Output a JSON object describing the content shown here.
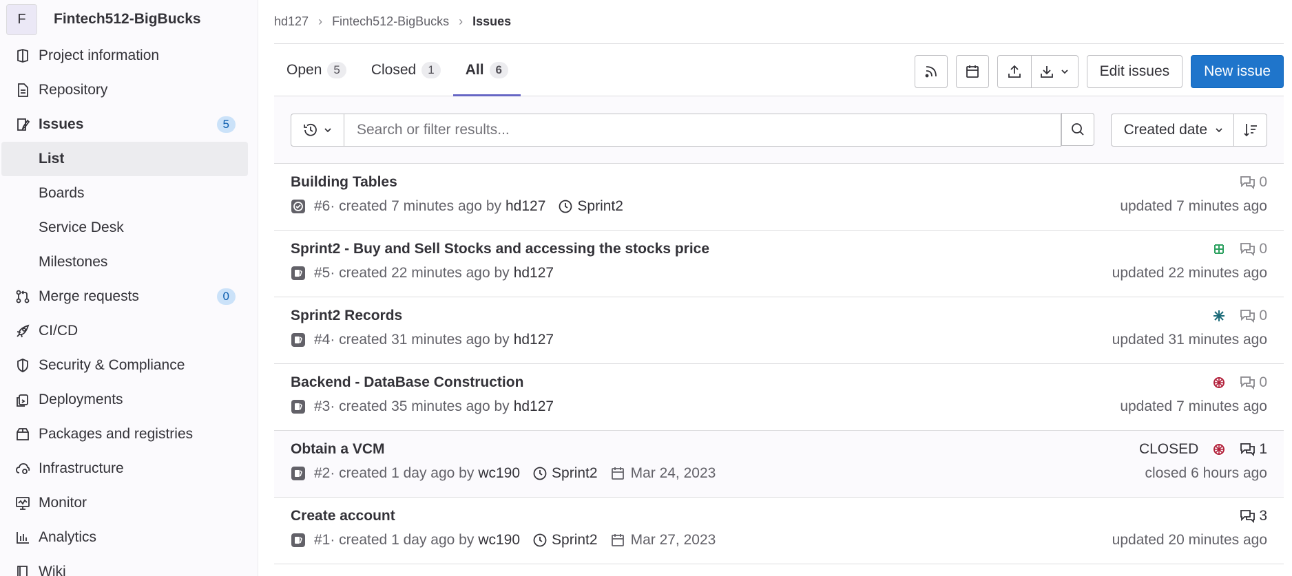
{
  "project": {
    "initial": "F",
    "name": "Fintech512-BigBucks"
  },
  "sidebar": {
    "items": [
      {
        "label": "Project information",
        "icon": "project-icon"
      },
      {
        "label": "Repository",
        "icon": "document-icon"
      },
      {
        "label": "Issues",
        "icon": "issues-icon",
        "badge": "5"
      },
      {
        "label": "List"
      },
      {
        "label": "Boards"
      },
      {
        "label": "Service Desk"
      },
      {
        "label": "Milestones"
      },
      {
        "label": "Merge requests",
        "icon": "merge-request-icon",
        "badge": "0"
      },
      {
        "label": "CI/CD",
        "icon": "rocket-icon"
      },
      {
        "label": "Security & Compliance",
        "icon": "shield-icon"
      },
      {
        "label": "Deployments",
        "icon": "deployments-icon"
      },
      {
        "label": "Packages and registries",
        "icon": "package-icon"
      },
      {
        "label": "Infrastructure",
        "icon": "cloud-gear-icon"
      },
      {
        "label": "Monitor",
        "icon": "monitor-icon"
      },
      {
        "label": "Analytics",
        "icon": "chart-icon"
      },
      {
        "label": "Wiki",
        "icon": "book-icon"
      }
    ]
  },
  "breadcrumbs": [
    "hd127",
    "Fintech512-BigBucks",
    "Issues"
  ],
  "tabs": [
    {
      "label": "Open",
      "count": "5"
    },
    {
      "label": "Closed",
      "count": "1"
    },
    {
      "label": "All",
      "count": "6"
    }
  ],
  "actions": {
    "edit_label": "Edit issues",
    "new_label": "New issue"
  },
  "search": {
    "placeholder": "Search or filter results..."
  },
  "sort": {
    "label": "Created date"
  },
  "issues": [
    {
      "title": "Building Tables",
      "ref": "#6",
      "created": " · created 7 minutes ago by",
      "author": "hd127",
      "milestone": "Sprint2",
      "due": "",
      "status_text": "",
      "comments": "0",
      "updated": "updated 7 minutes ago"
    },
    {
      "title": "Sprint2 - Buy and Sell Stocks and accessing the stocks price",
      "ref": "#5",
      "created": " · created 22 minutes ago by",
      "author": "hd127",
      "milestone": "",
      "due": "",
      "status_text": "",
      "comments": "0",
      "updated": "updated 22 minutes ago"
    },
    {
      "title": "Sprint2 Records",
      "ref": "#4",
      "created": " · created 31 minutes ago by",
      "author": "hd127",
      "milestone": "",
      "due": "",
      "status_text": "",
      "comments": "0",
      "updated": "updated 31 minutes ago"
    },
    {
      "title": "Backend - DataBase Construction",
      "ref": "#3",
      "created": " · created 35 minutes ago by",
      "author": "hd127",
      "milestone": "",
      "due": "",
      "status_text": "",
      "comments": "0",
      "updated": "updated 7 minutes ago"
    },
    {
      "title": "Obtain a VCM",
      "ref": "#2",
      "created": " · created 1 day ago by",
      "author": "wc190",
      "milestone": "Sprint2",
      "due": "Mar 24, 2023",
      "status_text": "CLOSED",
      "comments": "1",
      "updated": "closed 6 hours ago"
    },
    {
      "title": "Create account",
      "ref": "#1",
      "created": " · created 1 day ago by",
      "author": "wc190",
      "milestone": "Sprint2",
      "due": "Mar 27, 2023",
      "status_text": "",
      "comments": "3",
      "updated": "updated 20 minutes ago"
    }
  ],
  "colors": {
    "primary": "#1f75cb",
    "tab_active": "#6666c4",
    "badge_bg": "#cbe2f9"
  }
}
